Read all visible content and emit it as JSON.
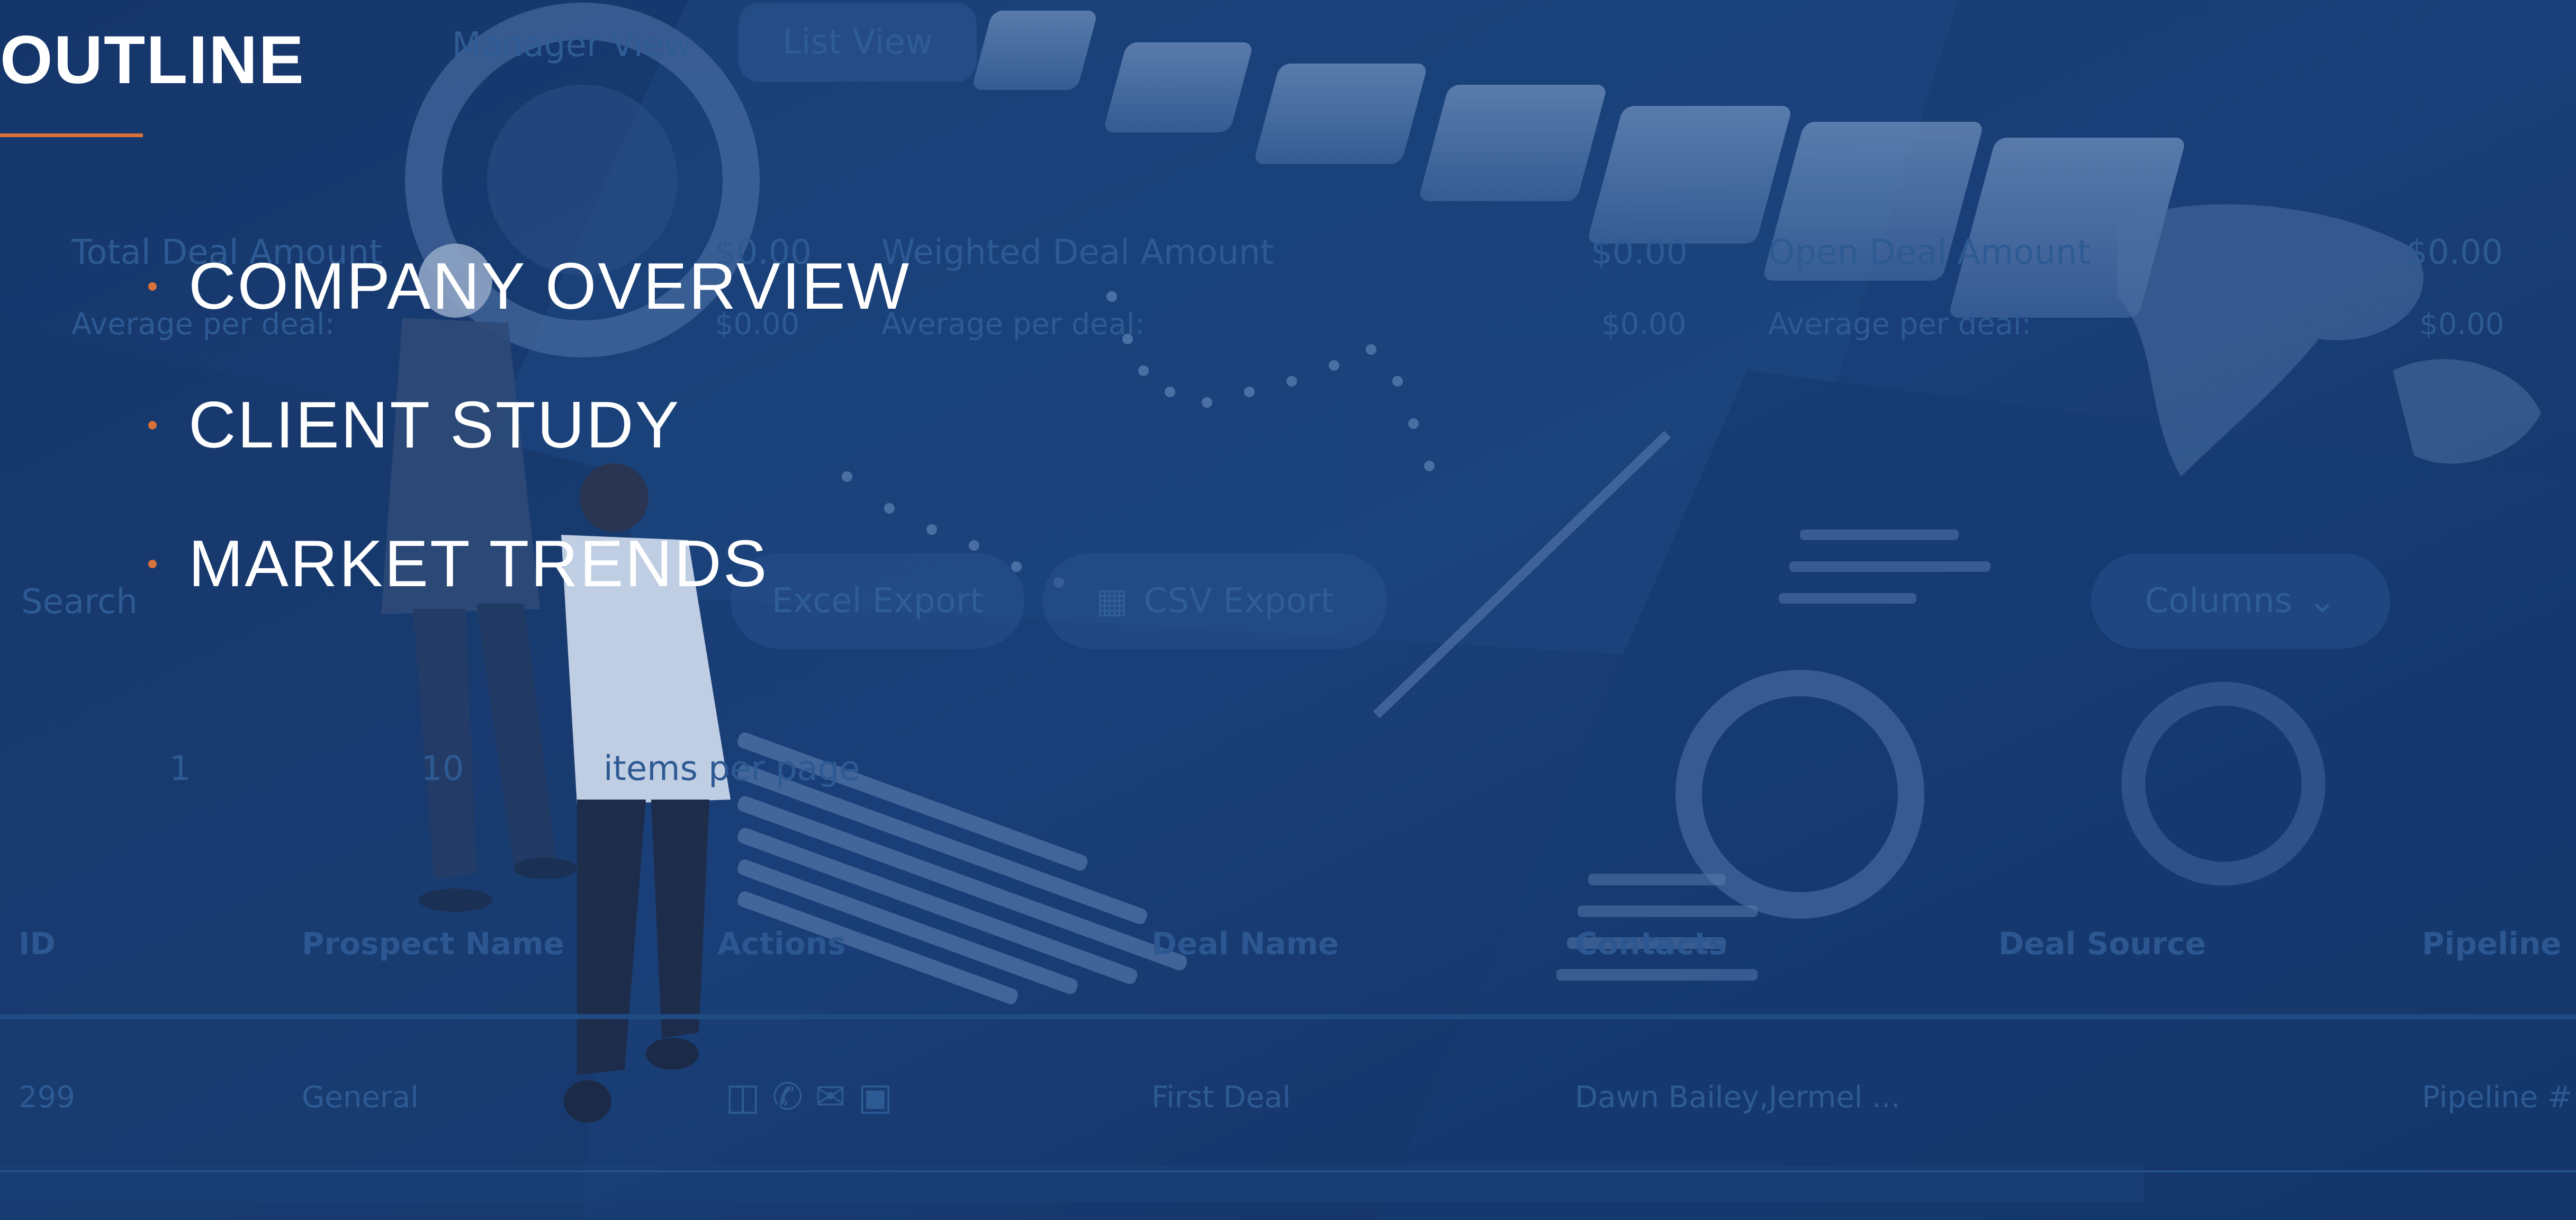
{
  "slide": {
    "title": "OUTLINE",
    "accent_color": "#d9713b",
    "bullets": [
      "COMPANY OVERVIEW",
      "CLIENT STUDY",
      "MARKET TRENDS"
    ]
  },
  "background_ui": {
    "view_tabs": [
      "Manager View",
      "List View"
    ],
    "active_tab": "List View",
    "summary": [
      {
        "label": "Total Deal Amount",
        "value": "$0.00",
        "avg_label": "Average per deal:",
        "avg_value": "$0.00"
      },
      {
        "label": "Weighted Deal Amount",
        "value": "$0.00",
        "avg_label": "Average per deal:",
        "avg_value": "$0.00"
      },
      {
        "label": "Open Deal Amount",
        "value": "$0.00",
        "avg_label": "Average per deal:",
        "avg_value": "$0.00"
      }
    ],
    "search_placeholder": "Search",
    "buttons": {
      "excel_export": "Excel Export",
      "csv_export": "CSV Export",
      "columns": "Columns"
    },
    "pagination": {
      "page": "1",
      "page_size": "10",
      "items_per_page": "items per page"
    },
    "table": {
      "headers": [
        "ID",
        "Prospect Name",
        "Actions",
        "Deal Name",
        "Contacts",
        "Deal Source",
        "Pipeline"
      ],
      "rows": [
        {
          "id": "299",
          "prospect_name": "General",
          "deal_name": "First Deal",
          "contacts": "Dawn Bailey,Jermel ...",
          "pipeline": "Pipeline #"
        }
      ]
    }
  }
}
